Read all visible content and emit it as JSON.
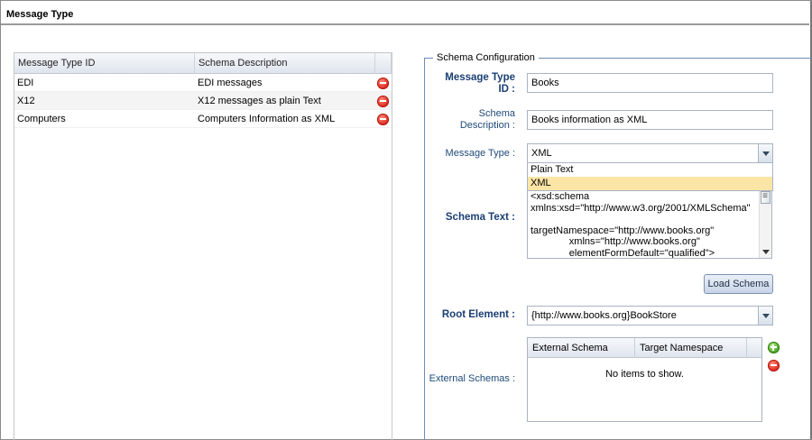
{
  "window": {
    "title": "Message Type"
  },
  "message_types_grid": {
    "columns": [
      "Message Type ID",
      "Schema Description"
    ],
    "rows": [
      {
        "id": "EDI",
        "description": "EDI messages"
      },
      {
        "id": "X12",
        "description": "X12 messages as plain Text"
      },
      {
        "id": "Computers",
        "description": "Computers Information as XML"
      }
    ]
  },
  "schema_config": {
    "legend": "Schema Configuration",
    "message_type_id_label_1": "Message Type",
    "message_type_id_label_2": "ID :",
    "message_type_id_value": "Books",
    "schema_description_label_1": "Schema",
    "schema_description_label_2": "Description :",
    "schema_description_value": "Books information as XML",
    "message_type_label": "Message Type :",
    "message_type_value": "XML",
    "message_type_options": [
      "Plain Text",
      "XML"
    ],
    "schema_text_label": "Schema Text :",
    "schema_text_value": "<xsd:schema\nxmlns:xsd=\"http://www.w3.org/2001/XMLSchema\"\n\ntargetNamespace=\"http://www.books.org\"\n              xmlns=\"http://www.books.org\"\n              elementFormDefault=\"qualified\">",
    "load_schema_label": "Load Schema",
    "root_element_label": "Root Element :",
    "root_element_value": "{http://www.books.org}BookStore",
    "external_schemas_label": "External Schemas :",
    "external_columns": [
      "External Schema",
      "Target Namespace"
    ],
    "external_empty_text": "No items to show."
  }
}
